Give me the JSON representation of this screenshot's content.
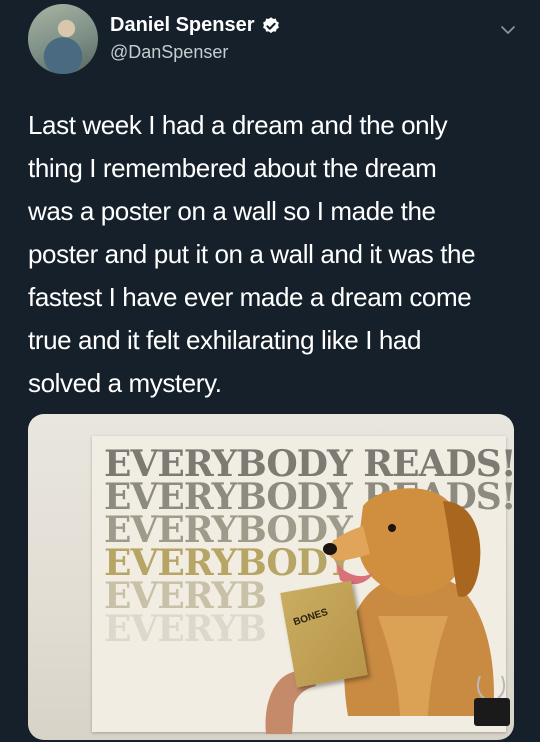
{
  "author": {
    "display_name": "Daniel Spenser",
    "handle": "@DanSpenser",
    "verified": true
  },
  "tweet": {
    "text": "Last week I had a dream and the only\nthing I remembered about the dream\nwas a poster on a wall so I made the\nposter and put it on a wall and it was the\nfastest I have ever made a dream come\ntrue and it felt exhilarating like I had\nsolved a mystery."
  },
  "media": {
    "poster_lines": [
      "EVERYBODY READS!",
      "EVERYBODY READS!",
      "EVERYBODY R",
      "EVERYBODY",
      "EVERYB",
      "EVERYB"
    ],
    "book_title": "BONES"
  },
  "icons": {
    "verified": "verified-badge-icon",
    "more": "chevron-down-icon"
  },
  "colors": {
    "background": "#15202b",
    "verified": "#ffffff"
  }
}
